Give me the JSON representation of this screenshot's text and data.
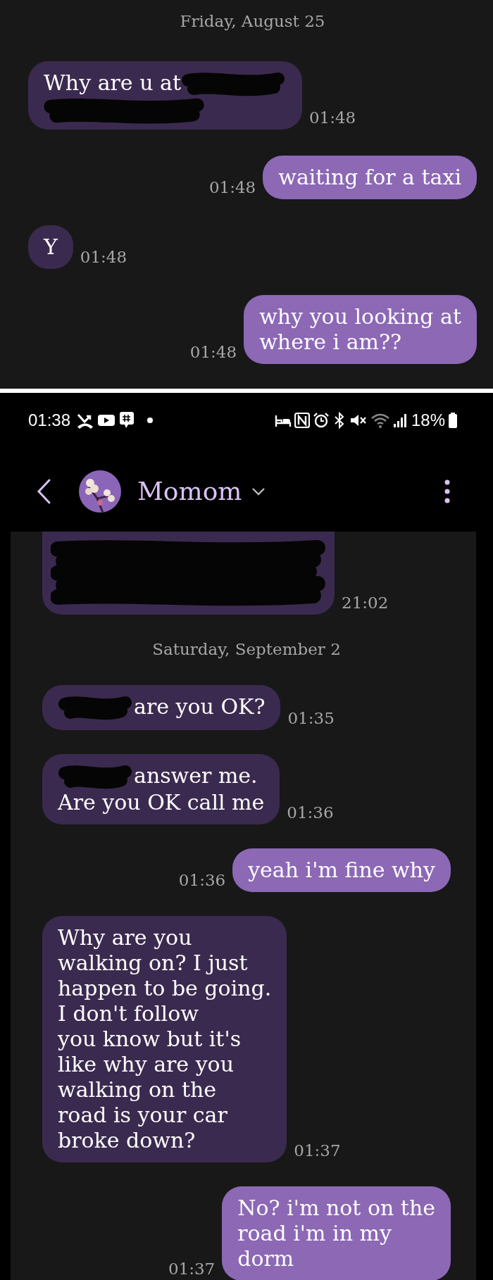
{
  "conversation_top": {
    "items": [
      {
        "kind": "date",
        "text": "Friday, August 25"
      },
      {
        "kind": "received-hidden-end",
        "lines": [
          "Why are u at"
        ],
        "time": "01:48"
      },
      {
        "kind": "sent",
        "lines": [
          "waiting for a taxi"
        ],
        "time": "01:48"
      },
      {
        "kind": "received",
        "lines": [
          "Y"
        ],
        "time": "01:48"
      },
      {
        "kind": "sent",
        "lines": [
          "why you looking at",
          "where i am??"
        ],
        "time": "01:48"
      }
    ]
  },
  "status_bar": {
    "time": "01:38",
    "battery": "18%"
  },
  "header": {
    "contact": "Momom"
  },
  "conversation": {
    "items": [
      {
        "kind": "received-hidden",
        "time": "21:02"
      },
      {
        "kind": "date",
        "text": "Saturday, September 2"
      },
      {
        "kind": "received-hidden-start",
        "lines": [
          "are you OK?"
        ],
        "time": "01:35"
      },
      {
        "kind": "received-hidden-start",
        "lines": [
          "answer me.",
          "Are you OK call me"
        ],
        "time": "01:36"
      },
      {
        "kind": "sent",
        "lines": [
          "yeah i'm fine why"
        ],
        "time": "01:36"
      },
      {
        "kind": "received",
        "lines": [
          "Why are you",
          "walking on? I just",
          "happen to be going.",
          "I don't follow",
          "you know but it's",
          "like why are you",
          "walking on the",
          "road is your car",
          "broke down?"
        ],
        "time": "01:37"
      },
      {
        "kind": "sent",
        "lines": [
          "No? i'm not on the",
          "road i'm in my",
          "dorm"
        ],
        "time": "01:37"
      }
    ]
  }
}
